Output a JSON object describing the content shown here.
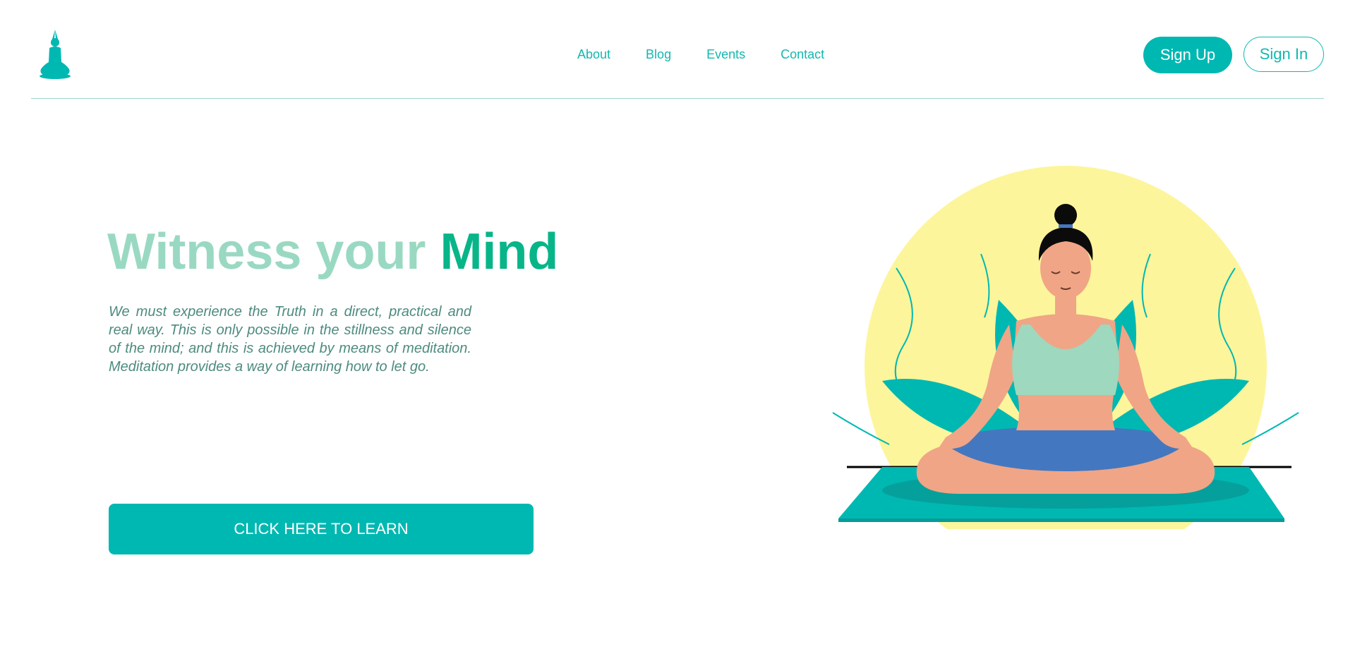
{
  "header": {
    "logo_icon": "meditation-logo-icon",
    "nav": [
      {
        "label": "About"
      },
      {
        "label": "Blog"
      },
      {
        "label": "Events"
      },
      {
        "label": "Contact"
      }
    ],
    "sign_up_label": "Sign Up",
    "sign_in_label": "Sign In"
  },
  "hero": {
    "title_light": "Witness your ",
    "title_strong": "Mind",
    "paragraph": "We must experience the Truth in a direct, practical and real way. This is only possible in the stillness and silence of the mind; and this is achieved by means of meditation. Meditation provides a way of learning how to let go.",
    "cta_label": "CLICK HERE TO LEARN"
  },
  "illustration": {
    "name": "meditating-woman-illustration"
  },
  "colors": {
    "accent": "#00b8b2",
    "title_light": "#9ad9c1",
    "title_strong": "#08b589",
    "paragraph": "#4d8b7f",
    "sun": "#fdf59b"
  }
}
